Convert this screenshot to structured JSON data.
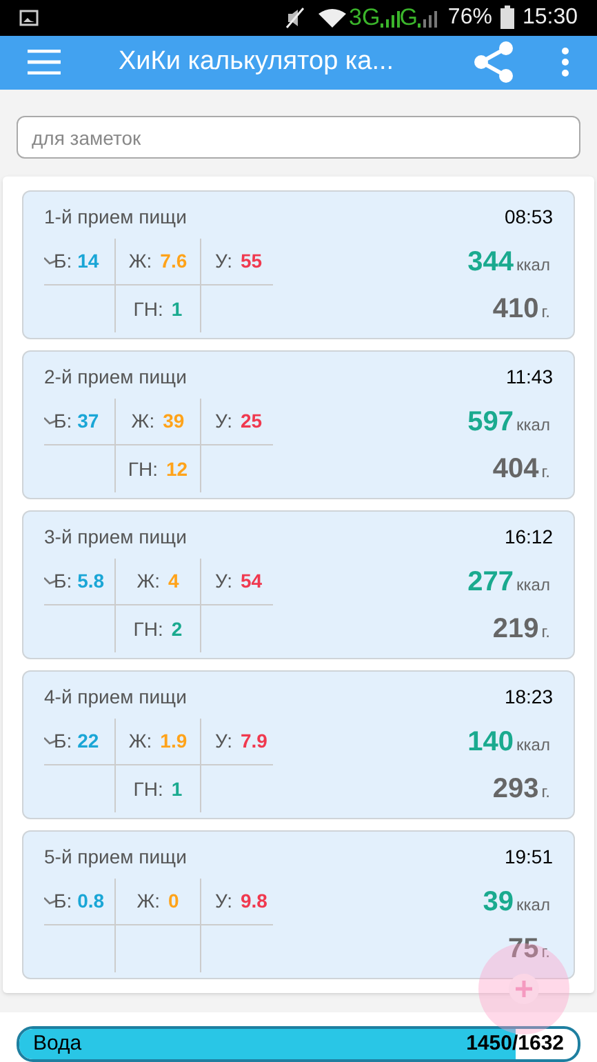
{
  "status_bar": {
    "network_1": "3G",
    "network_2": "G",
    "battery": "76%",
    "time": "15:30"
  },
  "app_bar": {
    "title": "ХиКи калькулятор ка..."
  },
  "notes": {
    "placeholder": "для заметок"
  },
  "meals": [
    {
      "title": "1-й прием пищи",
      "time": "08:53",
      "protein_label": "Б:",
      "protein": "14",
      "fat_label": "Ж:",
      "fat": "7.6",
      "carbs_label": "У:",
      "carbs": "55",
      "gn": {
        "label": "ГН:",
        "value": "1",
        "color": "#1aaa8f"
      },
      "kcal": "344",
      "kcal_unit": "ккал",
      "weight": "410",
      "weight_unit": "г."
    },
    {
      "title": "2-й прием пищи",
      "time": "11:43",
      "protein_label": "Б:",
      "protein": "37",
      "fat_label": "Ж:",
      "fat": "39",
      "carbs_label": "У:",
      "carbs": "25",
      "gn": {
        "label": "ГН:",
        "value": "12",
        "color": "#ffa31a"
      },
      "kcal": "597",
      "kcal_unit": "ккал",
      "weight": "404",
      "weight_unit": "г."
    },
    {
      "title": "3-й прием пищи",
      "time": "16:12",
      "protein_label": "Б:",
      "protein": "5.8",
      "fat_label": "Ж:",
      "fat": "4",
      "carbs_label": "У:",
      "carbs": "54",
      "gn": {
        "label": "ГН:",
        "value": "2",
        "color": "#1aaa8f"
      },
      "kcal": "277",
      "kcal_unit": "ккал",
      "weight": "219",
      "weight_unit": "г."
    },
    {
      "title": "4-й прием пищи",
      "time": "18:23",
      "protein_label": "Б:",
      "protein": "22",
      "fat_label": "Ж:",
      "fat": "1.9",
      "carbs_label": "У:",
      "carbs": "7.9",
      "gn": {
        "label": "ГН:",
        "value": "1",
        "color": "#1aaa8f"
      },
      "kcal": "140",
      "kcal_unit": "ккал",
      "weight": "293",
      "weight_unit": "г."
    },
    {
      "title": "5-й прием пищи",
      "time": "19:51",
      "protein_label": "Б:",
      "protein": "0.8",
      "fat_label": "Ж:",
      "fat": "0",
      "carbs_label": "У:",
      "carbs": "9.8",
      "kcal": "39",
      "kcal_unit": "ккал",
      "weight": "75",
      "weight_unit": "г."
    }
  ],
  "water": {
    "label": "Вода",
    "reading": "1450/1632",
    "level": 0.888
  }
}
